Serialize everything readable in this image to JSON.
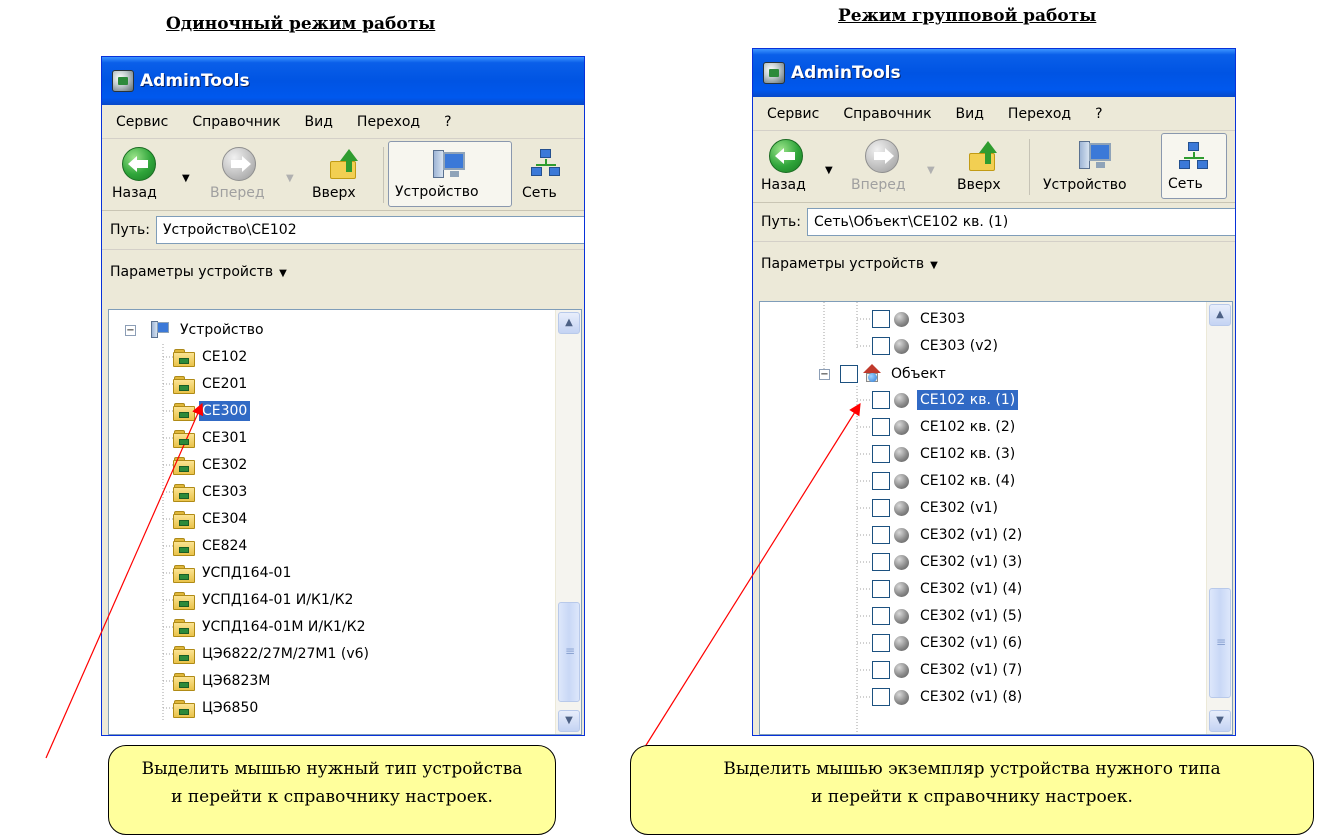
{
  "headings": {
    "left": "Одиночный режим работы",
    "right": "Режим групповой работы"
  },
  "windows": {
    "left": {
      "title": "AdminTools",
      "menu": [
        "Сервис",
        "Справочник",
        "Вид",
        "Переход",
        "?"
      ],
      "toolbar": {
        "back": "Назад",
        "forward": "Вперед",
        "up": "Вверх",
        "device": "Устройство",
        "network": "Сеть",
        "active": "device"
      },
      "path_label": "Путь:",
      "path_value": "Устройство\\CE102",
      "section": "Параметры устройств",
      "tree": {
        "root": "Устройство",
        "items": [
          "CE102",
          "CE201",
          "CE300",
          "CE301",
          "CE302",
          "CE303",
          "CE304",
          "CE824",
          "УСПД164-01",
          "УСПД164-01 И/К1/К2",
          "УСПД164-01М И/К1/К2",
          "ЦЭ6822/27М/27М1 (v6)",
          "ЦЭ6823М",
          "ЦЭ6850"
        ],
        "selected": "CE300"
      }
    },
    "right": {
      "title": "AdminTools",
      "menu": [
        "Сервис",
        "Справочник",
        "Вид",
        "Переход",
        "?"
      ],
      "toolbar": {
        "back": "Назад",
        "forward": "Вперед",
        "up": "Вверх",
        "device": "Устройство",
        "network": "Сеть",
        "active": "network"
      },
      "path_label": "Путь:",
      "path_value": "Сеть\\Объект\\CE102 кв. (1)",
      "section": "Параметры устройств",
      "tree": {
        "before": [
          "CE303",
          "CE303 (v2)"
        ],
        "group": "Объект",
        "items": [
          "CE102 кв. (1)",
          "CE102 кв. (2)",
          "CE102 кв. (3)",
          "CE102 кв. (4)",
          "CE302 (v1)",
          "CE302 (v1) (2)",
          "CE302 (v1) (3)",
          "CE302 (v1) (4)",
          "CE302 (v1) (5)",
          "CE302 (v1) (6)",
          "CE302 (v1) (7)",
          "CE302 (v1) (8)"
        ],
        "selected": "CE102 кв. (1)"
      }
    }
  },
  "callouts": {
    "left": [
      "Выделить мышью нужный тип устройства",
      "и перейти к справочнику настроек."
    ],
    "right": [
      "Выделить мышью экземпляр устройства нужного типа",
      "и перейти к справочнику настроек."
    ]
  },
  "colors": {
    "title_bar": "#0054e3",
    "selection": "#316ac5",
    "callout": "#ffff9c",
    "arrow": "#ff0000"
  }
}
